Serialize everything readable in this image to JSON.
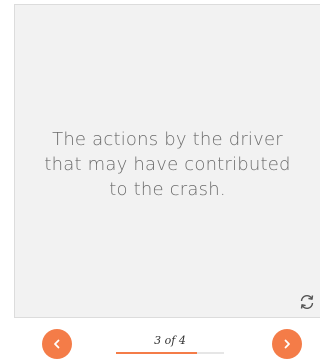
{
  "card": {
    "text": "The actions by the driver that may have contributed to the crash."
  },
  "pager": {
    "counter": "3 of 4",
    "progress": 0.75
  },
  "icons": {
    "flip": "flip-card-icon",
    "prev": "chevron-left-icon",
    "next": "chevron-right-icon"
  },
  "colors": {
    "accent": "#f47c48",
    "card_background": "#f2f2f2",
    "card_text": "#6b6b6b"
  }
}
